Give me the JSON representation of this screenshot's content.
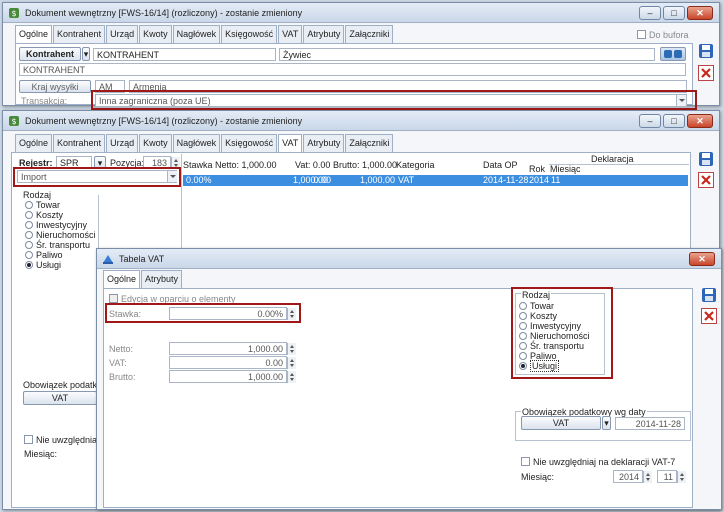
{
  "win1": {
    "title": "Dokument wewnętrzny [FWS-16/14] (rozliczony) - zostanie zmieniony",
    "tabs": [
      "Ogólne",
      "Kontrahent",
      "Urząd",
      "Kwoty",
      "Nagłówek",
      "Księgowość",
      "VAT",
      "Atrybuty",
      "Załączniki"
    ],
    "do_bufora": "Do bufora",
    "kontrahent_btn": "Kontrahent",
    "kontrahent_code": "KONTRAHENT",
    "kontrahent_city": "Żywiec",
    "kontrahent_name": "KONTRAHENT",
    "kraj_btn": "Kraj wysyłki",
    "kraj_code": "AM",
    "kraj_name": "Armenia",
    "transakcja_label": "Transakcja:",
    "transakcja_value": "Inna zagraniczna (poza UE)"
  },
  "win2": {
    "title": "Dokument wewnętrzny [FWS-16/14] (rozliczony) - zostanie zmieniony",
    "tabs": [
      "Ogólne",
      "Kontrahent",
      "Urząd",
      "Kwoty",
      "Nagłówek",
      "Księgowość",
      "VAT",
      "Atrybuty",
      "Załączniki"
    ],
    "rejestr_label": "Rejestr:",
    "rejestr_value": "SPR",
    "pozycja_label": "Pozycja:",
    "pozycja_value": "183",
    "import_value": "Import",
    "rodzaj_label": "Rodzaj",
    "rodzaj_options": [
      "Towar",
      "Koszty",
      "Inwestycyjny",
      "Nieruchomości",
      "Śr. transportu",
      "Paliwo",
      "Usługi"
    ],
    "grid_headers": {
      "stawka": "Stawka",
      "netto": "Netto: 1,000.00",
      "vat": "Vat: 0.00",
      "brutto": "Brutto: 1,000.00",
      "kategoria": "Kategoria",
      "data_op": "Data OP",
      "deklaracja": "Deklaracja",
      "rok": "Rok",
      "miesiac": "Miesiąc"
    },
    "grid_row": {
      "stawka": "0.00%",
      "netto": "1,000.00",
      "vat": "0.00",
      "brutto": "1,000.00",
      "kategoria": "VAT",
      "data_op": "2014-11-28",
      "rok": "2014",
      "miesiac": "11"
    },
    "obowiazek_label": "Obowiązek podatkow",
    "vat_btn": "VAT",
    "nie_uwzgl_label": "Nie uwzględniaj n",
    "miesiac_label": "Miesiąc:"
  },
  "tabela": {
    "title": "Tabela VAT",
    "tabs": [
      "Ogólne",
      "Atrybuty"
    ],
    "edycja_label": "Edycja w oparciu o elementy",
    "stawka_label": "Stawka:",
    "stawka_value": "0.00%",
    "netto_label": "Netto:",
    "netto_value": "1,000.00",
    "vat_label": "VAT:",
    "vat_value": "0.00",
    "brutto_label": "Brutto:",
    "brutto_value": "1,000.00",
    "rodzaj_label": "Rodzaj",
    "rodzaj_options": [
      "Towar",
      "Koszty",
      "Inwestycyjny",
      "Nieruchomości",
      "Śr. transportu",
      "Paliwo",
      "Usługi"
    ],
    "obowiazek_label": "Obowiązek podatkowy wg daty",
    "vat_btn": "VAT",
    "obowiazek_date": "2014-11-28",
    "nie_uwzgl_label": "Nie uwzględniaj na deklaracji VAT-7",
    "miesiac_label": "Miesiąc:",
    "rok_value": "2014",
    "miesiac_value": "11"
  },
  "colors": {
    "accent_red": "#a11818",
    "selection_blue": "#3c8fe0"
  }
}
